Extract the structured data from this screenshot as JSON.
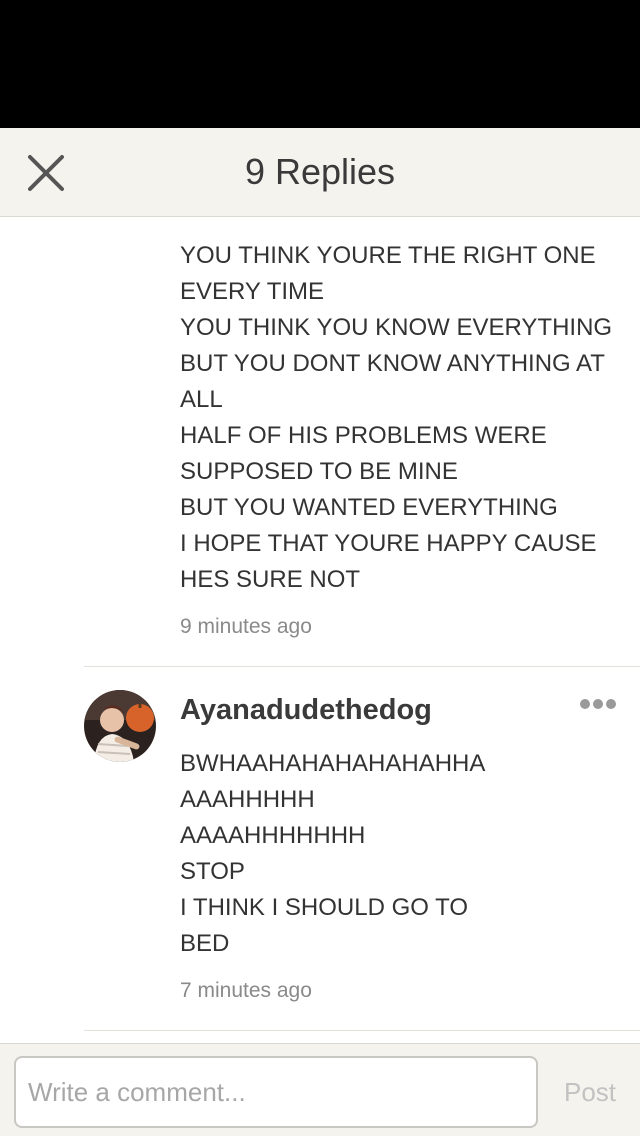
{
  "header": {
    "title": "9 Replies",
    "close_icon": "close-icon"
  },
  "replies": [
    {
      "lines": [
        "YOU THINK YOURE THE RIGHT ONE",
        "EVERY TIME",
        "YOU THINK YOU KNOW EVERYTHING",
        "BUT YOU DONT KNOW ANYTHING AT",
        "ALL",
        "HALF OF HIS PROBLEMS WERE",
        "SUPPOSED TO BE MINE",
        "BUT YOU WANTED EVERYTHING",
        "I HOPE THAT YOURE HAPPY CAUSE",
        "HES SURE NOT"
      ],
      "time": "9 minutes ago"
    },
    {
      "username": "Ayanadudethedog",
      "more_icon": "more-icon",
      "lines": [
        "BWHAAHAHAHAHAHAHHA",
        "AAAHHHHH",
        "AAAAHHHHHHH",
        "STOP",
        "I THINK I SHOULD GO TO",
        "BED"
      ],
      "time": "7 minutes ago"
    }
  ],
  "composer": {
    "placeholder": "Write a comment...",
    "value": "",
    "post_label": "Post"
  },
  "colors": {
    "status_bar": "#000000",
    "header_bg": "#f5f3ee",
    "text": "#333333",
    "muted": "#8a8a8a",
    "post_disabled": "#c2c2c2"
  }
}
